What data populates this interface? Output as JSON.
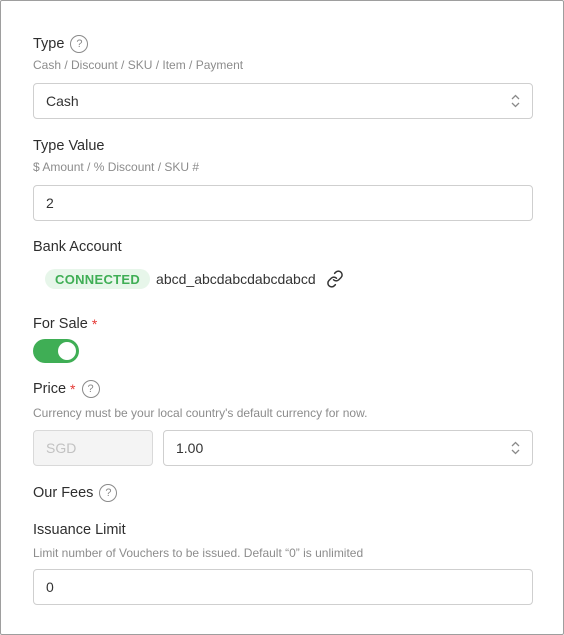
{
  "type_field": {
    "label": "Type",
    "hint": "Cash / Discount / SKU / Item / Payment",
    "value": "Cash"
  },
  "type_value_field": {
    "label": "Type Value",
    "hint": "$ Amount / % Discount / SKU #",
    "value": "2"
  },
  "bank_account": {
    "label": "Bank Account",
    "status": "CONNECTED",
    "account_id": "abcd_abcdabcdabcdabcd",
    "link_icon": "link-icon"
  },
  "for_sale": {
    "label": "For Sale",
    "required_mark": "*",
    "enabled": true
  },
  "price": {
    "label": "Price",
    "required_mark": "*",
    "hint": "Currency must be your local country's default currency for now.",
    "currency": "SGD",
    "value": "1.00"
  },
  "our_fees": {
    "label": "Our Fees"
  },
  "issuance_limit": {
    "label": "Issuance Limit",
    "hint": "Limit number of Vouchers to be issued. Default “0” is unlimited",
    "value": "0"
  },
  "colors": {
    "accent_green": "#3fae55",
    "badge_bg": "#e7f6ea",
    "required_red": "#e53935"
  }
}
